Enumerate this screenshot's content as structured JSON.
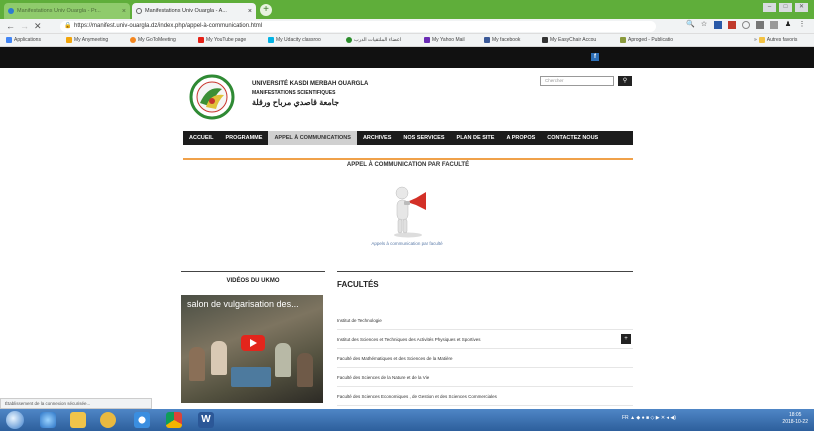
{
  "browser": {
    "tabs": [
      {
        "label": "Manifestations Univ Ouargla - Pr...",
        "active": false
      },
      {
        "label": "Manifestations Univ Ouargla - A...",
        "active": true
      }
    ],
    "url": "https://manifest.univ-ouargla.dz/index.php/appel-à-communication.html",
    "bookmarks": [
      {
        "label": "Applications",
        "color": "#4285f4"
      },
      {
        "label": "My Anymeeting",
        "color": "#f2a50a"
      },
      {
        "label": "My GoToMeeting",
        "color": "#f5871f"
      },
      {
        "label": "My YouTube page",
        "color": "#e62117"
      },
      {
        "label": "My Udacity classroo",
        "color": "#02b3e4"
      },
      {
        "label": "اعضاء الملتقيات الدرب",
        "color": "#2a8c2a"
      },
      {
        "label": "My Yahoo Mail",
        "color": "#6a2bb5"
      },
      {
        "label": "My facebook",
        "color": "#3b5998"
      },
      {
        "label": "My EasyChair Accou",
        "color": "#333333"
      },
      {
        "label": "Aproged - Publicatio",
        "color": "#8a9a3b"
      }
    ],
    "other_bookmarks": "Autres favoris",
    "status_text": "Établissement de la connexion sécurisée..."
  },
  "site": {
    "logo_lines": [
      "UNIVERSITÉ KASDI MERBAH OUARGLA",
      "MANIFESTATIONS SCIENTIFIQUES",
      "جامعة قاصدي مرباح ورقلة"
    ],
    "search_placeholder": "Chercher",
    "menu": [
      {
        "label": "ACCUEIL",
        "active": false
      },
      {
        "label": "PROGRAMME",
        "active": false
      },
      {
        "label": "APPEL À COMMUNICATIONS",
        "active": true
      },
      {
        "label": "ARCHIVES",
        "active": false
      },
      {
        "label": "NOS SERVICES",
        "active": false
      },
      {
        "label": "PLAN DE SITE",
        "active": false
      },
      {
        "label": "A PROPOS",
        "active": false
      },
      {
        "label": "CONTACTEZ NOUS",
        "active": false
      }
    ],
    "appel_title": "APPEL À COMMUNICATION PAR FACULTÉ",
    "figure_caption": "Appels à communication par faculté",
    "videos_title": "VIDÉOS DU UKMO",
    "video_title": "salon de vulgarisation des...",
    "facultes_title": "FACULTÉS",
    "facultes": [
      {
        "label": "Institut de Technologie",
        "expand": false
      },
      {
        "label": "Institut des Sciences et Techniques des Activités Physiques et Sportives",
        "expand": true
      },
      {
        "label": "Faculté des Mathématiques et des Sciences de la Matière",
        "expand": false
      },
      {
        "label": "Faculté des Sciences de la Nature et de la Vie",
        "expand": false
      },
      {
        "label": "Faculté des Sciences Economiques , de Gestion et des Sciences Commerciales",
        "expand": false
      }
    ]
  },
  "taskbar": {
    "language": "FR",
    "time": "18:05",
    "date": "2018-10-22"
  }
}
